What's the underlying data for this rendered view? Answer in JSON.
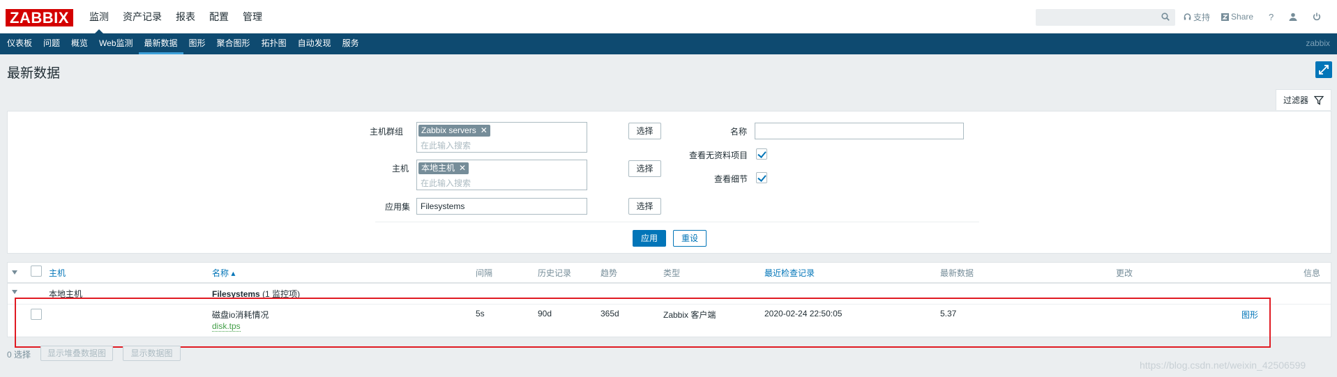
{
  "header": {
    "logo": "ZABBIX",
    "menu": [
      "监测",
      "资产记录",
      "报表",
      "配置",
      "管理"
    ],
    "support": "支持",
    "share": "Share",
    "help": "?"
  },
  "submenu": {
    "items": [
      "仪表板",
      "问题",
      "概览",
      "Web监测",
      "最新数据",
      "图形",
      "聚合图形",
      "拓扑图",
      "自动发现",
      "服务"
    ],
    "user": "zabbix"
  },
  "page": {
    "title": "最新数据"
  },
  "filter": {
    "tab_label": "过滤器",
    "host_group_label": "主机群组",
    "host_group_tag": "Zabbix servers",
    "search_placeholder": "在此输入搜索",
    "select_label": "选择",
    "host_label": "主机",
    "host_tag": "本地主机",
    "app_label": "应用集",
    "app_value": "Filesystems",
    "name_label": "名称",
    "name_value": "",
    "show_no_data_label": "查看无资料项目",
    "show_details_label": "查看细节",
    "apply_label": "应用",
    "reset_label": "重设"
  },
  "table": {
    "headers": {
      "host": "主机",
      "name": "名称 ▴",
      "interval": "间隔",
      "history": "历史记录",
      "trends": "趋势",
      "type": "类型",
      "last_check": "最近检查记录",
      "last_value": "最新数据",
      "change": "更改",
      "info": "信息"
    },
    "group": {
      "host": "本地主机",
      "app": "Filesystems",
      "count": "(1 监控项)"
    },
    "row": {
      "name": "磁盘io消耗情况",
      "key": "disk.tps",
      "interval": "5s",
      "history": "90d",
      "trends": "365d",
      "type": "Zabbix 客户端",
      "last_check": "2020-02-24 22:50:05",
      "last_value": "5.37",
      "graph_link": "图形"
    }
  },
  "footer": {
    "selected": "0 选择",
    "btn_stacked": "显示堆叠数据图",
    "btn_graph": "显示数据图"
  },
  "watermark": "https://blog.csdn.net/weixin_42506599",
  "colors": {
    "accent": "#0275b8",
    "nav": "#0e4a70",
    "brand": "#d40000",
    "highlight": "#e01a22"
  }
}
